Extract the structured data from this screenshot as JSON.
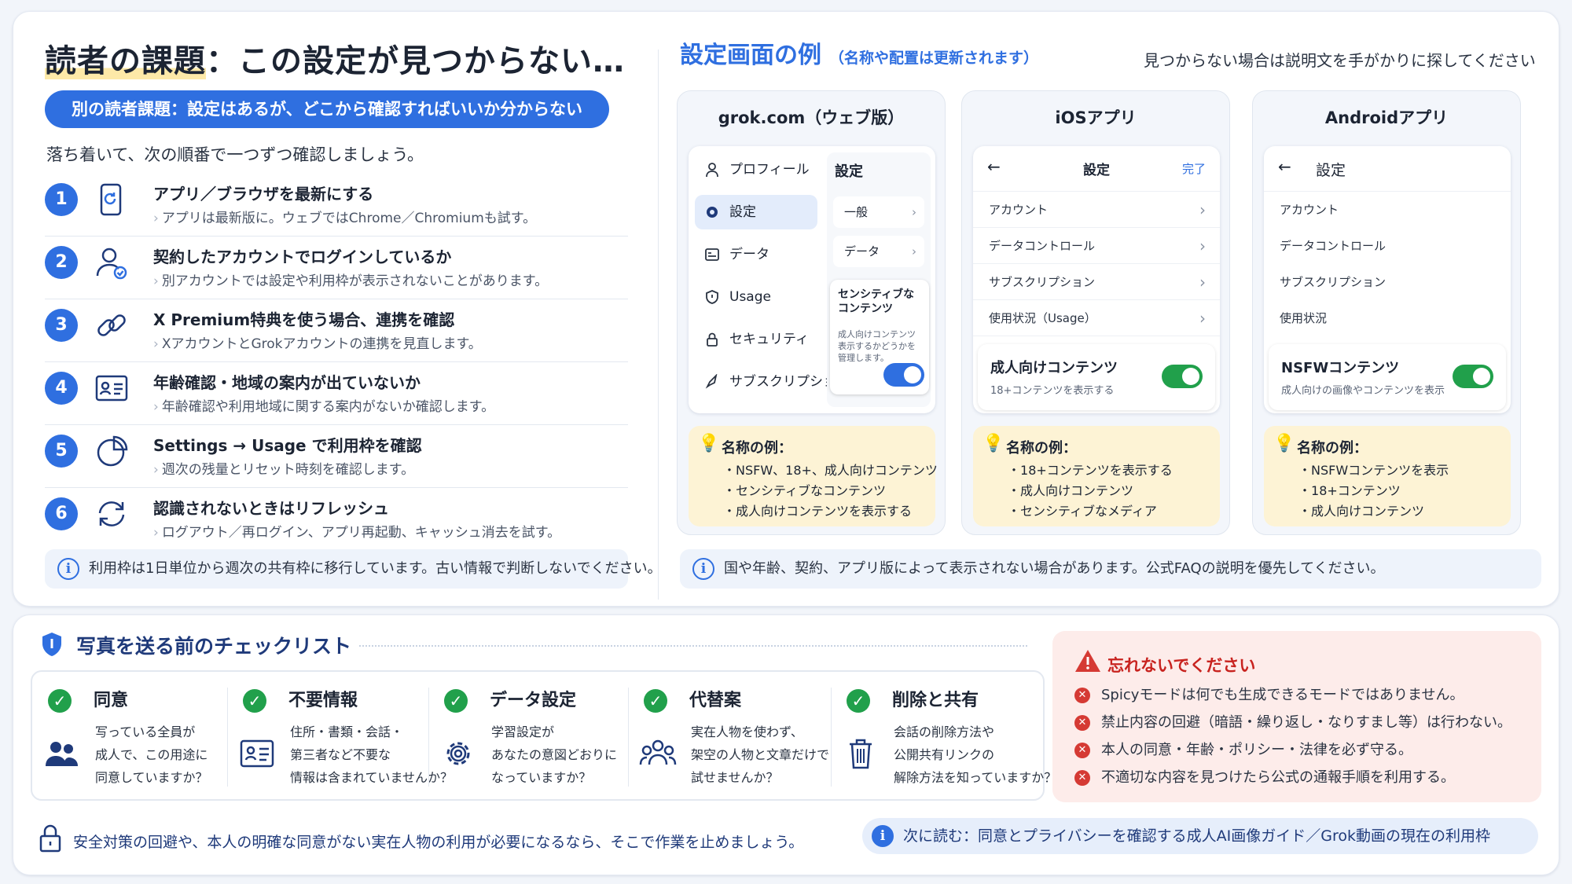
{
  "left": {
    "title_highlight": "読者の課題",
    "title_rest": "：この設定が見つからない…",
    "pill": "別の読者課題：設定はあるが、どこから確認すればいいか分からない",
    "intro": "落ち着いて、次の順番で一つずつ確認しましょう。",
    "steps": [
      {
        "num": "1",
        "icon": "phone-refresh-icon",
        "title": "アプリ／ブラウザを最新にする",
        "desc": "アプリは最新版に。ウェブではChrome／Chromiumも試す。"
      },
      {
        "num": "2",
        "icon": "user-check-icon",
        "title": "契約したアカウントでログインしているか",
        "desc": "別アカウントでは設定や利用枠が表示されないことがあります。"
      },
      {
        "num": "3",
        "icon": "link-icon",
        "title": "X Premium特典を使う場合、連携を確認",
        "desc": "XアカウントとGrokアカウントの連携を見直します。"
      },
      {
        "num": "4",
        "icon": "id-card-icon",
        "title": "年齢確認・地域の案内が出ていないか",
        "desc": "年齢確認や利用地域に関する案内がないか確認します。"
      },
      {
        "num": "5",
        "icon": "pie-chart-icon",
        "title": "Settings → Usage で利用枠を確認",
        "desc": "週次の残量とリセット時刻を確認します。"
      },
      {
        "num": "6",
        "icon": "refresh-icon",
        "title": "認識されないときはリフレッシュ",
        "desc": "ログアウト／再ログイン、アプリ再起動、キャッシュ消去を試す。"
      }
    ],
    "note": "利用枠は1日単位から週次の共有枠に移行しています。古い情報で判断しないでください。"
  },
  "right": {
    "title": "設定画面の例",
    "title_note": "（名称や配置は更新されます）",
    "hint": "見つからない場合は説明文を手がかりに探してください",
    "web": {
      "title": "grok.com（ウェブ版）",
      "menu": [
        "プロフィール",
        "設定",
        "データ",
        "Usage",
        "セキュリティ",
        "サブスクリプション"
      ],
      "active_index": 1,
      "settings_heading": "設定",
      "rows": [
        "一般",
        "データ"
      ],
      "sensitive_title": "センシティブな コンテンツ",
      "sensitive_desc": "成人向けコンテンツ 表示するかどうかを 管理します。",
      "toggle_on": true,
      "tip_title": "名称の例：",
      "tips": [
        "NSFW、18+、成人向けコンテンツ",
        "センシティブなコンテンツ",
        "成人向けコンテンツを表示する"
      ]
    },
    "ios": {
      "title": "iOSアプリ",
      "header": "設定",
      "done": "完了",
      "rows": [
        "アカウント",
        "データコントロール",
        "サブスクリプション",
        "使用状況（Usage）"
      ],
      "toggle_title": "成人向けコンテンツ",
      "toggle_desc": "18+コンテンツを表示する",
      "toggle_on": true,
      "tip_title": "名称の例：",
      "tips": [
        "18+コンテンツを表示する",
        "成人向けコンテンツ",
        "センシティブなメディア"
      ]
    },
    "android": {
      "title": "Androidアプリ",
      "header": "設定",
      "rows": [
        "アカウント",
        "データコントロール",
        "サブスクリプション",
        "使用状況"
      ],
      "toggle_title": "NSFWコンテンツ",
      "toggle_desc": "成人向けの画像やコンテンツを表示",
      "toggle_on": true,
      "tip_title": "名称の例：",
      "tips": [
        "NSFWコンテンツを表示",
        "18+コンテンツ",
        "成人向けコンテンツ"
      ]
    },
    "note": "国や年齢、契約、アプリ版によって表示されない場合があります。公式FAQの説明を優先してください。"
  },
  "checklist": {
    "title": "写真を送る前のチェックリスト",
    "items": [
      {
        "title": "同意",
        "icon": "people-icon",
        "desc": "写っている全員が\n成人で、この用途に\n同意していますか？"
      },
      {
        "title": "不要情報",
        "icon": "id-card-icon",
        "desc": "住所・書類・会話・\n第三者など不要な\n情報は含まれていませんか？"
      },
      {
        "title": "データ設定",
        "icon": "gear-icon",
        "desc": "学習設定が\nあなたの意図どおりに\nなっていますか？"
      },
      {
        "title": "代替案",
        "icon": "group-icon",
        "desc": "実在人物を使わず、\n架空の人物と文章だけで\n試せませんか？"
      },
      {
        "title": "削除と共有",
        "icon": "trash-icon",
        "desc": "会話の削除方法や\n公開共有リンクの\n解除方法を知っていますか？"
      }
    ]
  },
  "warning": {
    "title": "忘れないでください",
    "items": [
      "Spicyモードは何でも生成できるモードではありません。",
      "禁止内容の回避（暗語・繰り返し・なりすまし等）は行わない。",
      "本人の同意・年齢・ポリシー・法律を必ず守る。",
      "不適切な内容を見つけたら公式の通報手順を利用する。"
    ]
  },
  "footer": {
    "left": "安全対策の回避や、本人の明確な同意がない実在人物の利用が必要になるなら、そこで作業を止めましょう。",
    "right": "次に読む：同意とプライバシーを確認する成人AI画像ガイド／Grok動画の現在の利用枠"
  },
  "colors": {
    "accent": "#2f6fe0",
    "check": "#21a04b",
    "warn": "#d53a34",
    "tip_bg": "#fdf3d5"
  }
}
